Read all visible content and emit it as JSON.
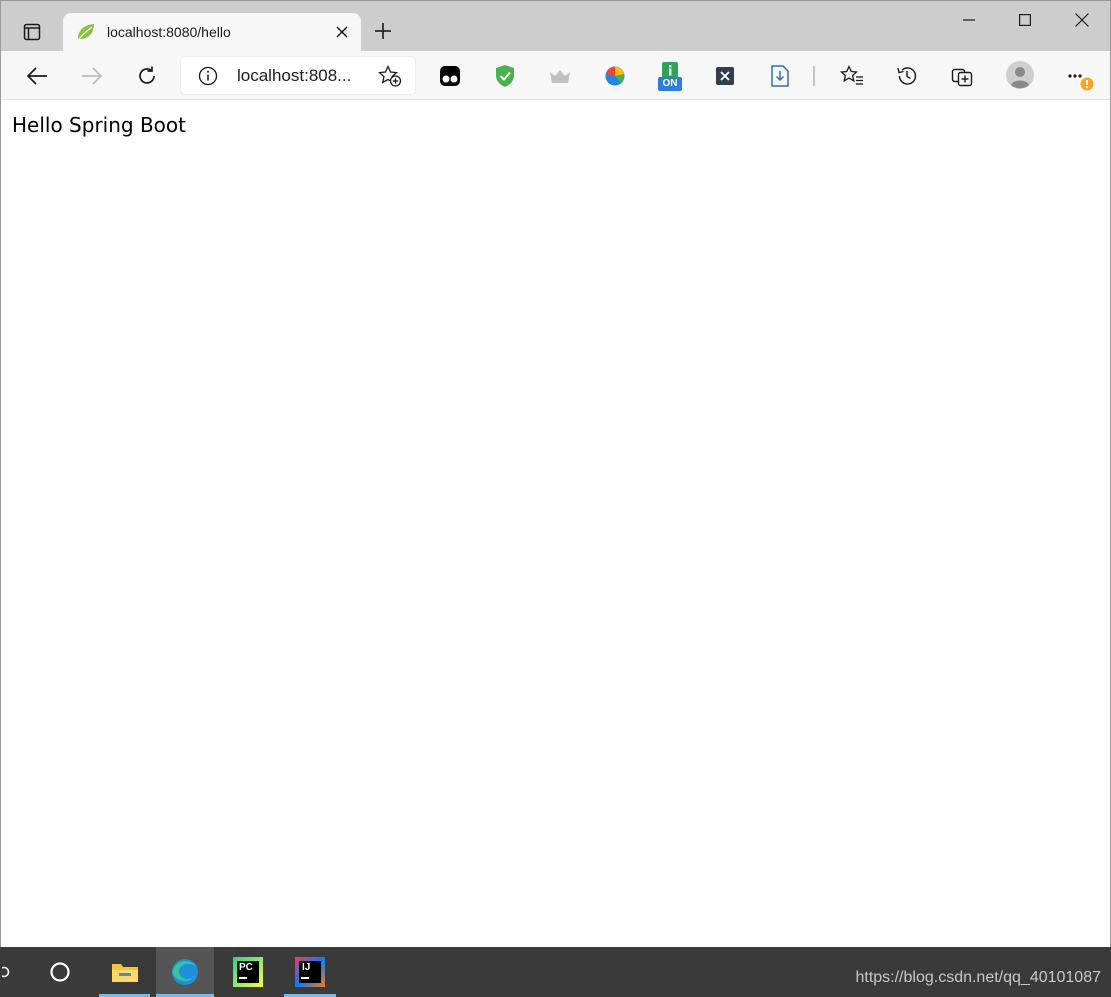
{
  "tab": {
    "title": "localhost:8080/hello"
  },
  "address_bar": {
    "url_display": "localhost:808..."
  },
  "extensions": {
    "badge_on": "ON"
  },
  "page": {
    "text": "Hello Spring Boot"
  },
  "taskbar": {
    "pycharm_label": "PC",
    "intellij_label": "IJ",
    "watermark": "https://blog.csdn.net/qq_40101087"
  },
  "colors": {
    "tabstrip_bg": "#cdcdcd",
    "toolbar_bg": "#f7f7f7",
    "taskbar_bg": "#3a3a3a",
    "taskbar_active": "#76b9ed",
    "favicon_green": "#8cc04b"
  },
  "icons": {
    "tab_actions": "tab-actions-icon",
    "favicon": "spring-leaf-icon",
    "close": "close-icon",
    "new_tab": "plus-icon",
    "back": "arrow-left-icon",
    "forward": "arrow-right-icon",
    "refresh": "refresh-icon",
    "info": "info-icon",
    "add_favorite": "star-plus-icon",
    "favorites": "favorites-icon",
    "history": "history-icon",
    "collections": "collections-icon",
    "profile": "avatar-icon",
    "more": "more-icon"
  }
}
